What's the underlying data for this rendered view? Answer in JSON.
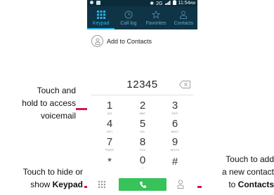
{
  "status_bar": {
    "network": "2G",
    "time": "11:54",
    "ampm": "AM"
  },
  "tabs": [
    {
      "label": "Keypad",
      "icon": "keypad-grid-icon",
      "active": true
    },
    {
      "label": "Call log",
      "icon": "clock-icon",
      "active": false
    },
    {
      "label": "Favorites",
      "icon": "star-icon",
      "active": false
    },
    {
      "label": "Contacts",
      "icon": "person-icon",
      "active": false
    }
  ],
  "add_to_contacts": {
    "label": "Add to Contacts",
    "icon": "add-contact-icon"
  },
  "dialer": {
    "number": "12345",
    "backspace_icon": "backspace-icon"
  },
  "keypad": {
    "keys": [
      {
        "digit": "1",
        "letters": "QO"
      },
      {
        "digit": "2",
        "letters": "ABC"
      },
      {
        "digit": "3",
        "letters": "DEF"
      },
      {
        "digit": "4",
        "letters": "GHI"
      },
      {
        "digit": "5",
        "letters": "JKL"
      },
      {
        "digit": "6",
        "letters": "MNO"
      },
      {
        "digit": "7",
        "letters": "PQRS"
      },
      {
        "digit": "8",
        "letters": "TUV"
      },
      {
        "digit": "9",
        "letters": "WXYZ"
      },
      {
        "digit": "*",
        "letters": ""
      },
      {
        "digit": "0",
        "letters": "+"
      },
      {
        "digit": "#",
        "letters": ""
      }
    ]
  },
  "bottom_bar": {
    "toggle_keypad_icon": "keypad-grid-icon",
    "call_icon": "phone-icon",
    "add_contact_icon": "person-icon"
  },
  "callouts": {
    "voicemail": {
      "line1": "Touch and",
      "line2": "hold to access",
      "line3": "voicemail"
    },
    "keypad": {
      "line1": "Touch to hide or",
      "line2_prefix": "show ",
      "line2_bold": "Keypad"
    },
    "contacts": {
      "line1": "Touch to add",
      "line2": "a new contact",
      "line3_prefix": "to ",
      "line3_bold": "Contacts"
    }
  },
  "colors": {
    "accent": "#2ab4e8",
    "tabbar_bg": "#0f3446",
    "call_green": "#37c25a",
    "callout_pointer": "#d2145a"
  }
}
